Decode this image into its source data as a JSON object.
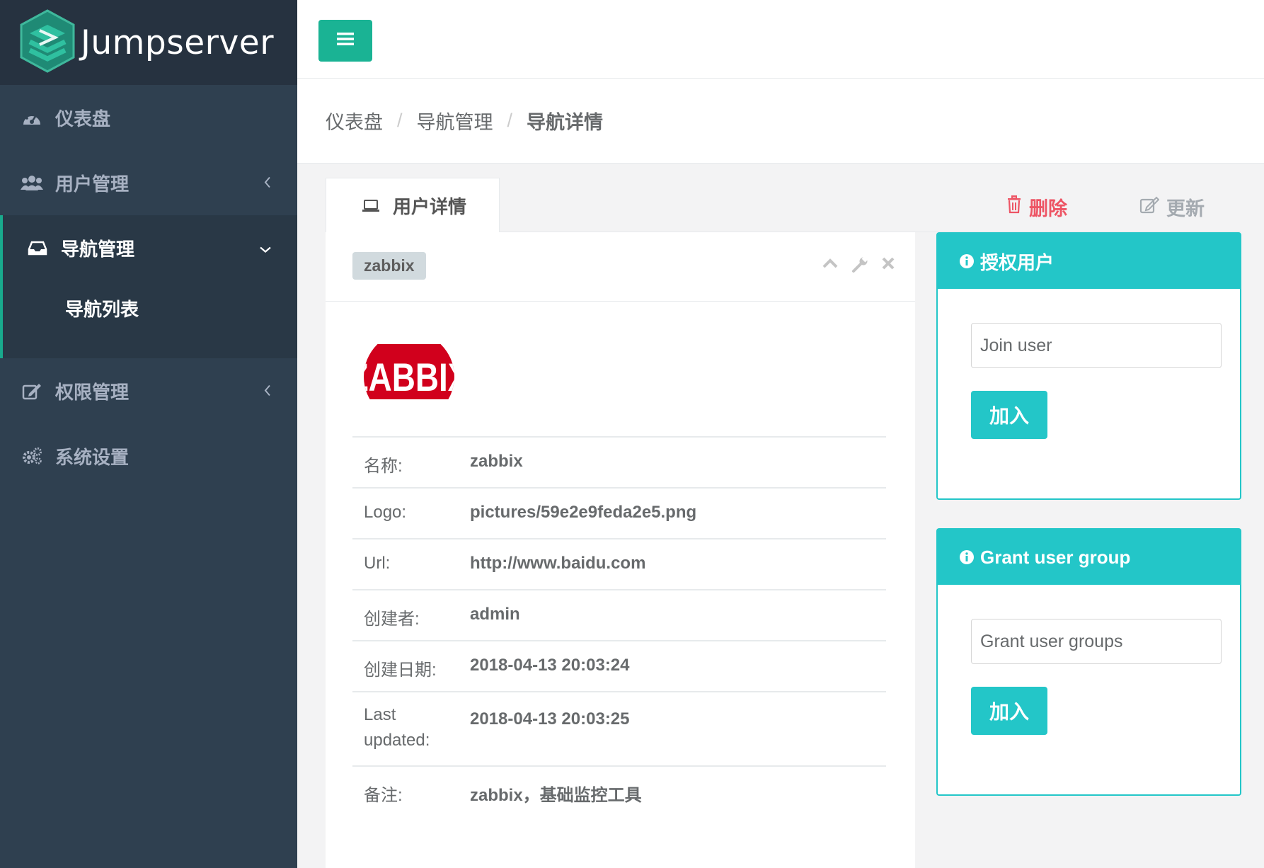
{
  "brand": {
    "name": "Jumpserver"
  },
  "sidebar": {
    "items": [
      {
        "label": "仪表盘",
        "icon": "dashboard-icon"
      },
      {
        "label": "用户管理",
        "icon": "users-icon",
        "has_children": true
      },
      {
        "label": "导航管理",
        "icon": "inbox-icon",
        "expanded": true,
        "children": [
          {
            "label": "导航列表"
          }
        ]
      },
      {
        "label": "权限管理",
        "icon": "edit-icon",
        "has_children": true
      },
      {
        "label": "系统设置",
        "icon": "cogs-icon"
      }
    ]
  },
  "topbar": {
    "menu_icon": "hamburger-icon"
  },
  "breadcrumb": [
    "仪表盘",
    "导航管理",
    "导航详情"
  ],
  "tabs": {
    "active_label": "用户详情",
    "delete_label": "删除",
    "update_label": "更新"
  },
  "detail": {
    "title": "zabbix",
    "logo_text": "ZABBIX",
    "rows": [
      {
        "key": "名称:",
        "value": "zabbix"
      },
      {
        "key": "Logo:",
        "value": "pictures/59e2e9feda2e5.png"
      },
      {
        "key": "Url:",
        "value": "http://www.baidu.com"
      },
      {
        "key": "创建者:",
        "value": "admin"
      },
      {
        "key": "创建日期:",
        "value": "2018-04-13 20:03:24"
      },
      {
        "key": "Last updated:",
        "value": "2018-04-13 20:03:25"
      },
      {
        "key": "备注:",
        "value": "zabbix，基础监控工具"
      }
    ]
  },
  "grant_user": {
    "title": "授权用户",
    "placeholder": "Join user",
    "button": "加入"
  },
  "grant_group": {
    "title": "Grant user group",
    "placeholder": "Grant user groups",
    "button": "加入"
  },
  "colors": {
    "sidebar_bg": "#2f4050",
    "primary": "#1ab394",
    "info": "#23c6c8",
    "danger": "#ed5565"
  }
}
